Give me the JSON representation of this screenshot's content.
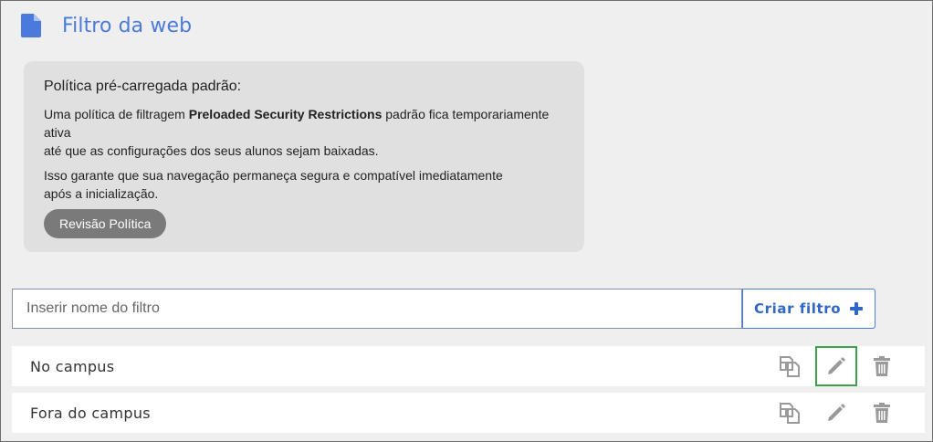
{
  "header": {
    "title": "Filtro da web",
    "icon": "document-icon",
    "icon_color": "#4a7bdc"
  },
  "policy": {
    "heading": "Política pré-carregada padrão:",
    "text1_prefix": "Uma política de filtragem ",
    "text1_bold": "Preloaded Security Restrictions",
    "text1_suffix": " padrão fica temporariamente ativa",
    "text1_line2": "até que as configurações dos seus alunos sejam baixadas.",
    "text2_line1": "Isso garante que sua navegação permaneça segura e compatível imediatamente",
    "text2_line2": "após a inicialização.",
    "review_button": "Revisão Política"
  },
  "create": {
    "input_placeholder": "Inserir nome do filtro",
    "input_value": "",
    "button_label": "Criar filtro",
    "button_icon": "plus-icon",
    "accent": "#2f66c9"
  },
  "filters": [
    {
      "name": "No campus",
      "actions": [
        "copy-icon",
        "pencil-icon",
        "trash-icon"
      ],
      "highlighted_action": "pencil-icon"
    },
    {
      "name": "Fora do campus",
      "actions": [
        "copy-icon",
        "pencil-icon",
        "trash-icon"
      ],
      "highlighted_action": ""
    }
  ],
  "colors": {
    "highlight_border": "#3ea24a",
    "icon_gray": "#9a9a9a"
  }
}
